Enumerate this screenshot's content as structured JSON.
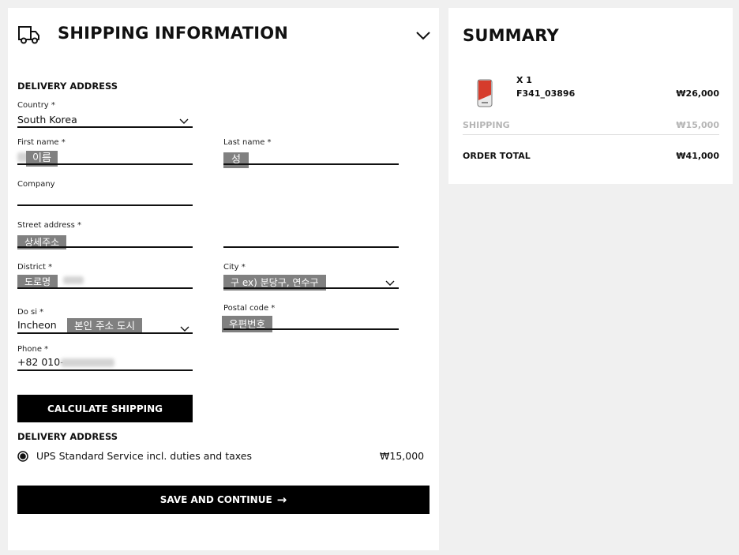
{
  "shipping": {
    "title": "SHIPPING INFORMATION",
    "delivery_address_heading": "DELIVERY ADDRESS",
    "country": {
      "label": "Country *",
      "value": "South Korea"
    },
    "first_name": {
      "label": "First name *",
      "value": "이름"
    },
    "last_name": {
      "label": "Last name *",
      "value": "성"
    },
    "company": {
      "label": "Company",
      "value": ""
    },
    "street": {
      "label": "Street address *",
      "value": "상세주소",
      "value2": ""
    },
    "district": {
      "label": "District *",
      "value": "도로명"
    },
    "city": {
      "label": "City *",
      "value": "구 ex) 분당구, 연수구"
    },
    "do_si": {
      "label": "Do si *",
      "value": "Incheon",
      "overlay": "본인 주소 도시"
    },
    "postal_code": {
      "label": "Postal code *",
      "value": "우편번호"
    },
    "phone": {
      "label": "Phone *",
      "prefix": "+82 010-"
    },
    "calculate_button": "CALCULATE SHIPPING",
    "delivery_method_heading": "DELIVERY ADDRESS",
    "delivery_option": {
      "label": "UPS Standard Service incl. duties and taxes",
      "price": "₩15,000",
      "selected": true
    },
    "save_button": "SAVE AND CONTINUE",
    "save_arrow": "→"
  },
  "summary": {
    "title": "SUMMARY",
    "item": {
      "qty": "X 1",
      "sku": "F341_03896",
      "price": "₩26,000",
      "icon": "phone-case-icon"
    },
    "shipping_label": "SHIPPING",
    "shipping_value": "₩15,000",
    "total_label": "ORDER TOTAL",
    "total_value": "₩41,000"
  }
}
